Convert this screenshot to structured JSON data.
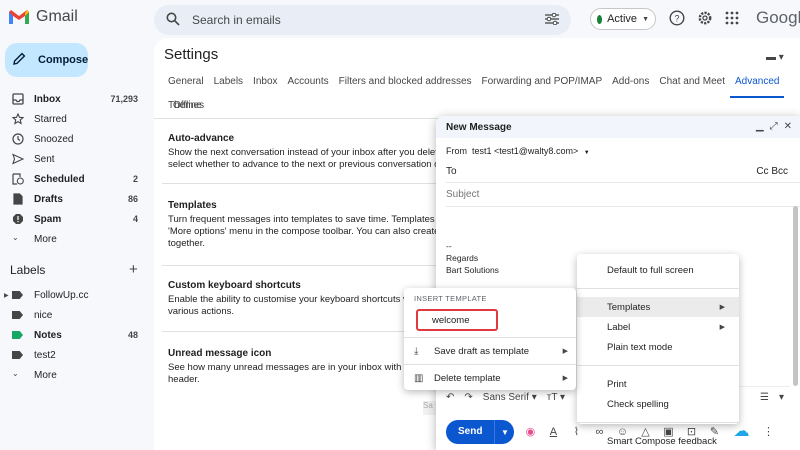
{
  "app": {
    "name": "Gmail",
    "brand": "Google"
  },
  "search": {
    "placeholder": "Search in emails"
  },
  "status": {
    "label": "Active",
    "color": "#188038"
  },
  "compose_button": "Compose",
  "nav": [
    {
      "label": "Inbox",
      "count": "71,293",
      "bold": true,
      "icon": "inbox-icon"
    },
    {
      "label": "Starred",
      "count": "",
      "bold": false,
      "icon": "star-icon"
    },
    {
      "label": "Snoozed",
      "count": "",
      "bold": false,
      "icon": "clock-icon"
    },
    {
      "label": "Sent",
      "count": "",
      "bold": false,
      "icon": "send-icon"
    },
    {
      "label": "Scheduled",
      "count": "2",
      "bold": true,
      "icon": "schedule-icon"
    },
    {
      "label": "Drafts",
      "count": "86",
      "bold": true,
      "icon": "draft-icon"
    },
    {
      "label": "Spam",
      "count": "4",
      "bold": true,
      "icon": "spam-icon"
    },
    {
      "label": "More",
      "count": "",
      "bold": false,
      "icon": "chevron-down-icon"
    }
  ],
  "labels": {
    "heading": "Labels",
    "items": [
      {
        "label": "FollowUp.cc",
        "count": "",
        "bold": false
      },
      {
        "label": "nice",
        "count": "",
        "bold": false
      },
      {
        "label": "Notes",
        "count": "48",
        "bold": true
      },
      {
        "label": "test2",
        "count": "",
        "bold": false
      },
      {
        "label": "More",
        "count": "",
        "bold": false
      }
    ]
  },
  "settings": {
    "title": "Settings",
    "tabs": [
      "General",
      "Labels",
      "Inbox",
      "Accounts",
      "Filters and blocked addresses",
      "Forwarding and POP/IMAP",
      "Add-ons",
      "Chat and Meet",
      "Advanced",
      "Offline"
    ],
    "active_tab": "Advanced",
    "tab_row2": "Themes",
    "sections": [
      {
        "title": "Auto-advance",
        "body": "Show the next conversation instead of your inbox after you delete, ar select whether to advance to the next or previous conversation on th"
      },
      {
        "title": "Templates",
        "body": "Turn frequent messages into templates to save time. Templates can l 'More options' menu in the compose toolbar. You can also create aut together."
      },
      {
        "title": "Custom keyboard shortcuts",
        "body": "Enable the ability to customise your keyboard shortcuts via a keys to various actions."
      },
      {
        "title": "Unread message icon",
        "body": "See how many unread messages are in your inbox with a qu the tab header."
      }
    ]
  },
  "compose": {
    "title": "New Message",
    "from_label": "From",
    "from_value": "test1 <test1@walty8.com>",
    "to_label": "To",
    "cc_bcc": "Cc Bcc",
    "subject_placeholder": "Subject",
    "signature": [
      "--",
      "Regards",
      "Bart Solutions"
    ],
    "font_label": "Sans Serif",
    "send": "Send",
    "partial_button": "Sa"
  },
  "more_menu": [
    {
      "label": "Default to full screen",
      "arrow": false,
      "sep_after": true
    },
    {
      "label": "Templates",
      "arrow": true,
      "sep_after": false,
      "highlight": true
    },
    {
      "label": "Label",
      "arrow": true,
      "sep_after": false
    },
    {
      "label": "Plain text mode",
      "arrow": false,
      "sep_after": true
    },
    {
      "label": "Print",
      "arrow": false,
      "sep_after": false
    },
    {
      "label": "Check spelling",
      "arrow": false,
      "sep_after": true
    },
    {
      "label": "Smart Compose feedback",
      "arrow": false,
      "sep_after": false
    }
  ],
  "template_menu": {
    "heading": "INSERT TEMPLATE",
    "welcome": "welcome",
    "save_draft": "Save draft as template",
    "delete": "Delete template"
  }
}
